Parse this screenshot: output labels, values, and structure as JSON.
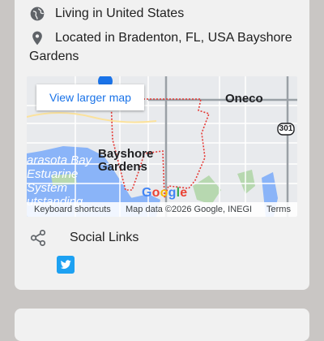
{
  "profile": {
    "living": "Living in United States",
    "location": "Located in Bradenton, FL, USA Bayshore Gardens"
  },
  "map": {
    "view_larger_label": "View larger map",
    "labels": {
      "oneco": "Oneco",
      "bayshore_line1": "Bayshore",
      "bayshore_line2": "Gardens",
      "route": "301",
      "bay_line1": "arasota Bay",
      "bay_line2": "Estuarine",
      "bay_line3": "System",
      "bay_line4": "utstanding"
    },
    "logo": [
      "G",
      "o",
      "o",
      "g",
      "l",
      "e"
    ],
    "attribution": {
      "shortcuts": "Keyboard shortcuts",
      "map_data": "Map data ©2026 Google, INEGI",
      "terms": "Terms"
    }
  },
  "social": {
    "label": "Social Links",
    "links": [
      {
        "icon": "twitter-icon",
        "color": "#1da1f2"
      }
    ]
  },
  "colors": {
    "background": "#c9c6c4",
    "card": "#f1f1f1",
    "link": "#1a73e8",
    "boundary": "#e53935"
  }
}
